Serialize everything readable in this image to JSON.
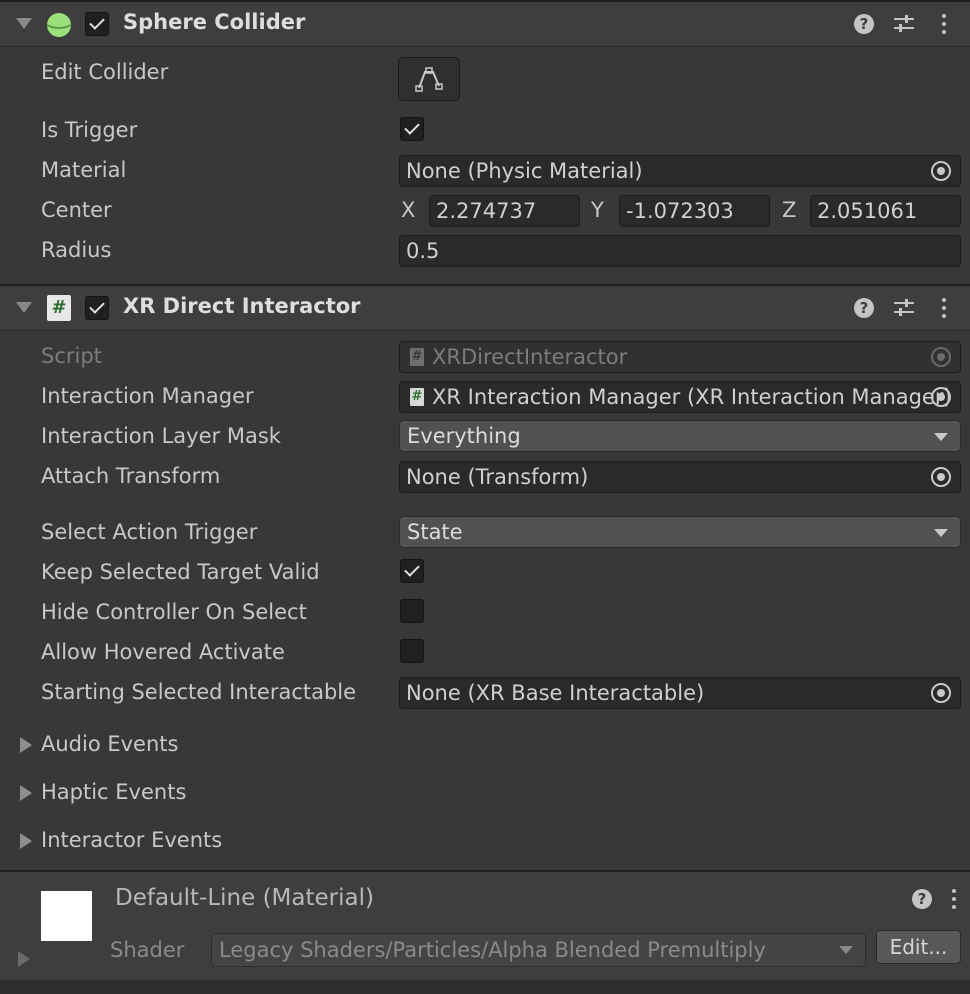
{
  "sphere_collider": {
    "title": "Sphere Collider",
    "enabled": true,
    "edit_collider_label": "Edit Collider",
    "is_trigger_label": "Is Trigger",
    "is_trigger": true,
    "material_label": "Material",
    "material_value": "None (Physic Material)",
    "center_label": "Center",
    "center": {
      "x_label": "X",
      "x": "2.274737",
      "y_label": "Y",
      "y": "-1.072303",
      "z_label": "Z",
      "z": "2.051061"
    },
    "radius_label": "Radius",
    "radius_value": "0.5"
  },
  "xr_direct_interactor": {
    "title": "XR Direct Interactor",
    "enabled": true,
    "script_label": "Script",
    "script_value": "XRDirectInteractor",
    "interaction_manager_label": "Interaction Manager",
    "interaction_manager_value": "XR Interaction Manager (XR Interaction Manager)",
    "interaction_layer_mask_label": "Interaction Layer Mask",
    "interaction_layer_mask_value": "Everything",
    "attach_transform_label": "Attach Transform",
    "attach_transform_value": "None (Transform)",
    "select_action_trigger_label": "Select Action Trigger",
    "select_action_trigger_value": "State",
    "keep_selected_label": "Keep Selected Target Valid",
    "keep_selected": true,
    "hide_controller_label": "Hide Controller On Select",
    "hide_controller": false,
    "allow_hovered_label": "Allow Hovered Activate",
    "allow_hovered": false,
    "starting_selected_label": "Starting Selected Interactable",
    "starting_selected_value": "None (XR Base Interactable)",
    "foldouts": [
      "Audio Events",
      "Haptic Events",
      "Interactor Events"
    ]
  },
  "material": {
    "title": "Default-Line (Material)",
    "shader_label": "Shader",
    "shader_value": "Legacy Shaders/Particles/Alpha Blended Premultiply",
    "edit_label": "Edit...",
    "swatch_color": "#ffffff"
  },
  "colors": {
    "background": "#383838",
    "header": "#3e3e3e",
    "sphere_icon": "#9ae07a",
    "script_icon_hash": "#2e6e2e"
  }
}
